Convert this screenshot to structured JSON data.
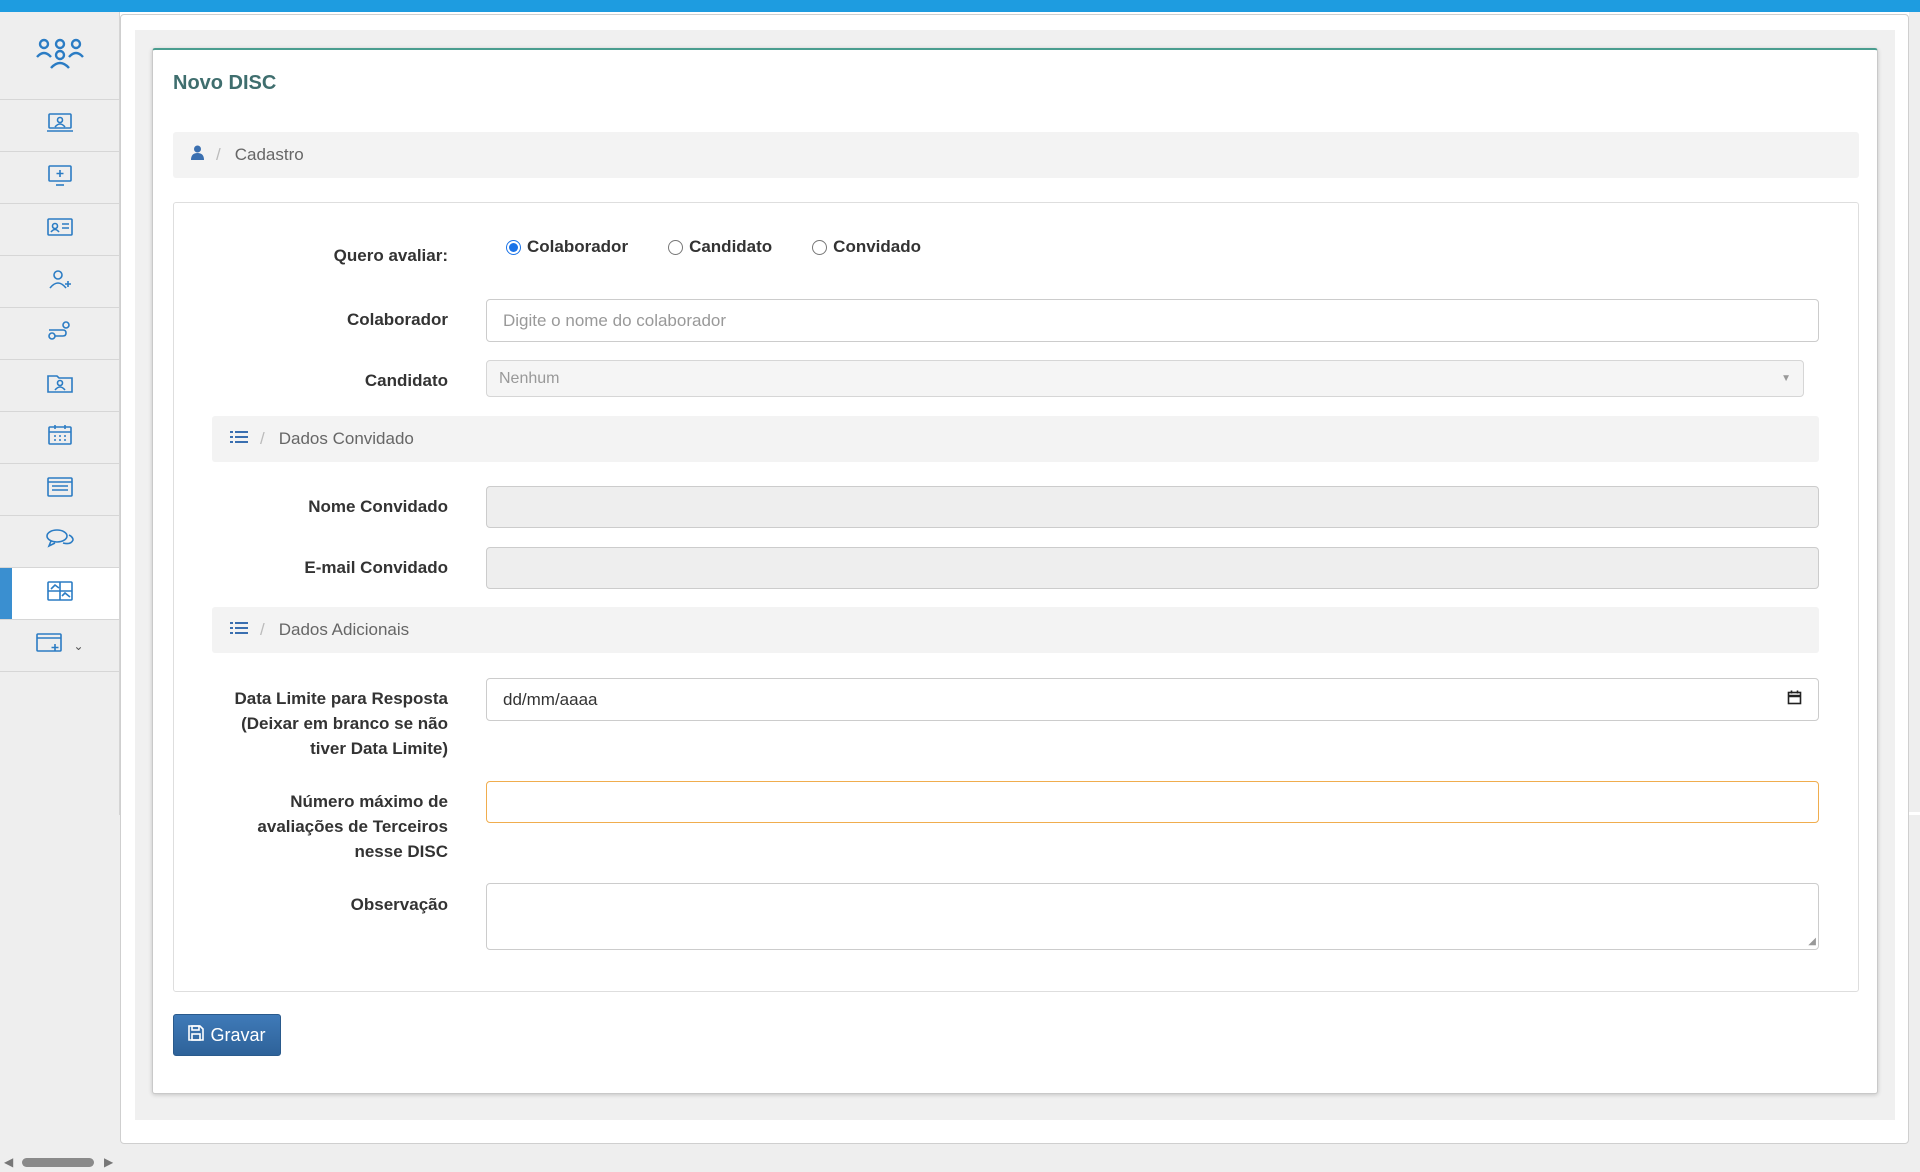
{
  "colors": {
    "topbar": "#1e9ce0",
    "accent": "#2b7cc4",
    "button": "#3670ab",
    "warning_border": "#f0ad4e"
  },
  "sidebar": {
    "logo_icon": "people-group-icon",
    "items": [
      {
        "icon": "laptop-user-icon",
        "active": false
      },
      {
        "icon": "monitor-add-icon",
        "active": false
      },
      {
        "icon": "id-card-icon",
        "active": false
      },
      {
        "icon": "user-add-icon",
        "active": false
      },
      {
        "icon": "user-route-icon",
        "active": false
      },
      {
        "icon": "folder-user-icon",
        "active": false
      },
      {
        "icon": "calendar-icon",
        "active": false
      },
      {
        "icon": "list-window-icon",
        "active": false
      },
      {
        "icon": "chat-bubbles-icon",
        "active": false
      },
      {
        "icon": "disc-chart-icon",
        "active": true
      },
      {
        "icon": "window-add-icon",
        "active": false,
        "has_dropdown": true
      }
    ]
  },
  "page": {
    "title": "Novo DISC",
    "breadcrumb": {
      "icon": "user-icon",
      "label": "Cadastro"
    }
  },
  "form": {
    "avaliar": {
      "label": "Quero avaliar:",
      "options": [
        {
          "label": "Colaborador",
          "selected": true
        },
        {
          "label": "Candidato",
          "selected": false
        },
        {
          "label": "Convidado",
          "selected": false
        }
      ]
    },
    "colaborador": {
      "label": "Colaborador",
      "value": "",
      "placeholder": "Digite o nome do colaborador"
    },
    "candidato": {
      "label": "Candidato",
      "selected": "Nenhum"
    },
    "section_convidado": {
      "icon": "list-icon",
      "label": "Dados Convidado"
    },
    "nome_convidado": {
      "label": "Nome Convidado",
      "value": ""
    },
    "email_convidado": {
      "label": "E-mail Convidado",
      "value": ""
    },
    "section_adicionais": {
      "icon": "list-icon",
      "label": "Dados Adicionais"
    },
    "data_limite": {
      "label_line1": "Data Limite para Resposta",
      "label_line2": "(Deixar em branco se não",
      "label_line3": "tiver Data Limite)",
      "placeholder": "dd/mm/aaaa"
    },
    "numero_maximo": {
      "label_line1": "Número máximo de",
      "label_line2": "avaliações de Terceiros",
      "label_line3": "nesse DISC",
      "value": ""
    },
    "observacao": {
      "label": "Observação",
      "value": ""
    },
    "save_button": {
      "label": "Gravar",
      "icon": "floppy-disk-icon"
    }
  }
}
